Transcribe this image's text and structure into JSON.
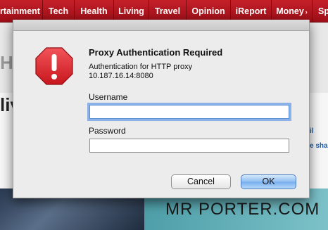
{
  "background": {
    "nav_items": [
      {
        "label": "rtainment",
        "chevron": ""
      },
      {
        "label": "Tech",
        "chevron": ""
      },
      {
        "label": "Health",
        "chevron": ""
      },
      {
        "label": "Living",
        "chevron": ""
      },
      {
        "label": "Travel",
        "chevron": ""
      },
      {
        "label": "Opinion",
        "chevron": ""
      },
      {
        "label": "iReport",
        "chevron": ""
      },
      {
        "label": "Money",
        "chevron": "›"
      },
      {
        "label": "Sp",
        "chevron": ""
      }
    ],
    "big_text_left": "H",
    "headline_left": "liv",
    "snippet_1": "il",
    "snippet_2": "e shar",
    "ad_text": "MR PORTER.COM",
    "nav_color": "#b8141f"
  },
  "dialog": {
    "icon": "stop-warning-icon",
    "icon_color": "#e0252b",
    "title": "Proxy Authentication Required",
    "message_line1": "Authentication for HTTP proxy",
    "message_line2": "10.187.16.14:8080",
    "username_label": "Username",
    "username_value": "",
    "password_label": "Password",
    "password_value": "",
    "cancel_label": "Cancel",
    "ok_label": "OK"
  }
}
